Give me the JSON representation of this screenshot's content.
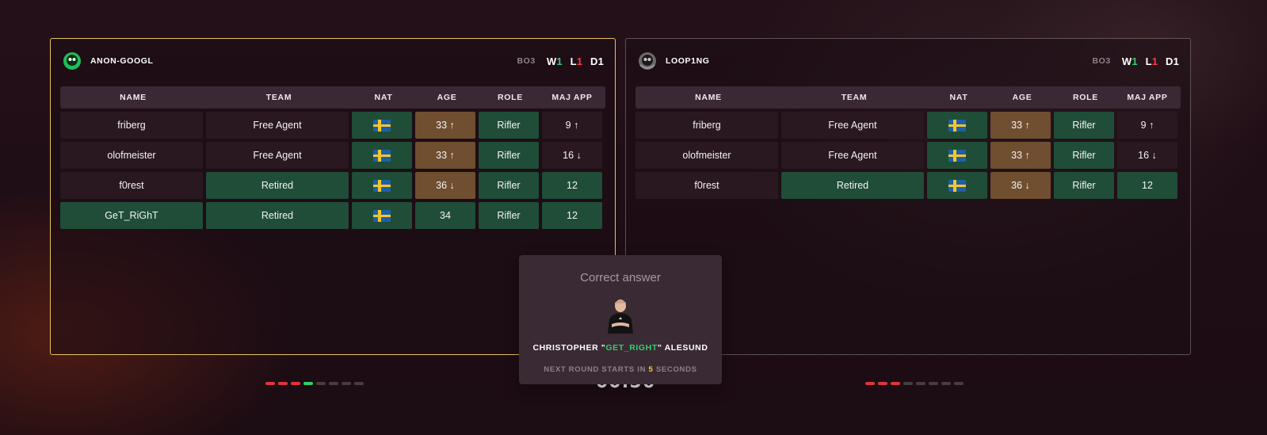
{
  "panels": [
    {
      "team_name": "ANON-GOOGL",
      "format": "BO3",
      "record": {
        "w_label": "W",
        "w": "1",
        "l_label": "L",
        "l": "1",
        "d_label": "D",
        "d": "1"
      },
      "columns": [
        "NAME",
        "TEAM",
        "NAT",
        "AGE",
        "ROLE",
        "MAJ APP"
      ],
      "rows": [
        {
          "name": "friberg",
          "team": "Free Agent",
          "age": "33 ↑",
          "role": "Rifler",
          "maj": "9 ↑"
        },
        {
          "name": "olofmeister",
          "team": "Free Agent",
          "age": "33 ↑",
          "role": "Rifler",
          "maj": "16 ↓"
        },
        {
          "name": "f0rest",
          "team": "Retired",
          "age": "36 ↓",
          "role": "Rifler",
          "maj": "12"
        },
        {
          "name": "GeT_RiGhT",
          "team": "Retired",
          "age": "34",
          "role": "Rifler",
          "maj": "12"
        }
      ]
    },
    {
      "team_name": "LOOP1NG",
      "format": "BO3",
      "record": {
        "w_label": "W",
        "w": "1",
        "l_label": "L",
        "l": "1",
        "d_label": "D",
        "d": "1"
      },
      "columns": [
        "NAME",
        "TEAM",
        "NAT",
        "AGE",
        "ROLE",
        "MAJ APP"
      ],
      "rows": [
        {
          "name": "friberg",
          "team": "Free Agent",
          "age": "33 ↑",
          "role": "Rifler",
          "maj": "9 ↑"
        },
        {
          "name": "olofmeister",
          "team": "Free Agent",
          "age": "33 ↑",
          "role": "Rifler",
          "maj": "16 ↓"
        },
        {
          "name": "f0rest",
          "team": "Retired",
          "age": "36 ↓",
          "role": "Rifler",
          "maj": "12"
        }
      ]
    }
  ],
  "timer": "00:56",
  "modal": {
    "title": "Correct answer",
    "player_first": "CHRISTOPHER \"",
    "player_nick": "GET_RIGHT",
    "player_last": "\" ALESUND",
    "next_prefix": "NEXT ROUND STARTS IN ",
    "next_seconds": "5",
    "next_suffix": " SECONDS"
  },
  "colors": {
    "accent_green": "#2fd06a",
    "accent_red": "#e0353c",
    "accent_yellow": "#f7d12a",
    "cell_green": "#1f4d38",
    "cell_brown": "#704e30"
  },
  "icons": [
    "team-logo-anon-icon",
    "team-logo-looping-icon",
    "sweden-flag-icon",
    "player-avatar"
  ]
}
